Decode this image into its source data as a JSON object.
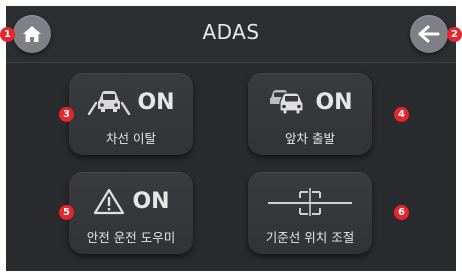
{
  "header": {
    "title": "ADAS",
    "home_icon": "home-icon",
    "back_icon": "arrow-left-icon"
  },
  "tiles": [
    {
      "status": "ON",
      "label": "차선 이탈",
      "icon": "lane-departure-car-icon"
    },
    {
      "status": "ON",
      "label": "앞차 출발",
      "icon": "front-car-departure-icon"
    },
    {
      "status": "ON",
      "label": "안전 운전 도우미",
      "icon": "warning-triangle-icon"
    },
    {
      "status": "",
      "label": "기준선 위치 조절",
      "icon": "baseline-adjust-icon"
    }
  ],
  "markers": [
    "1",
    "2",
    "3",
    "4",
    "5",
    "6"
  ],
  "colors": {
    "panel_bg": "#2a2b2e",
    "tile_bg": "#36373b",
    "round_button": "#7f8085",
    "marker": "#e8252a",
    "text": "#e6e6e6"
  }
}
